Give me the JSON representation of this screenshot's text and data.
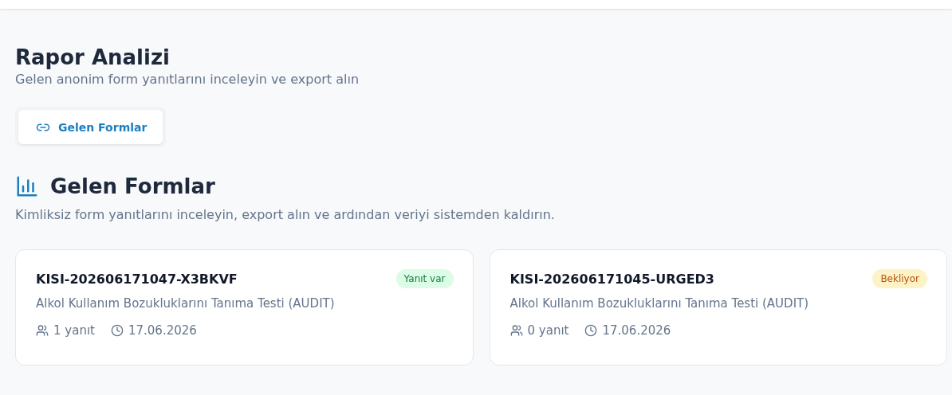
{
  "page": {
    "title": "Rapor Analizi",
    "subtitle": "Gelen anonim form yanıtlarını inceleyin ve export alın"
  },
  "tabs": [
    {
      "label": "Gelen Formlar",
      "selected": true
    }
  ],
  "section": {
    "title": "Gelen Formlar",
    "description": "Kimliksiz form yanıtlarını inceleyin, export alın ve ardından veriyi sistemden kaldırın."
  },
  "forms": [
    {
      "code": "KISI-202606171047-X3BKVF",
      "test": "Alkol Kullanım Bozukluklarını Tanıma Testi (AUDIT)",
      "responses": "1 yanıt",
      "date": "17.06.2026",
      "status": {
        "kind": "answered",
        "label": "Yanıt var"
      }
    },
    {
      "code": "KISI-202606171045-URGED3",
      "test": "Alkol Kullanım Bozukluklarını Tanıma Testi (AUDIT)",
      "responses": "0 yanıt",
      "date": "17.06.2026",
      "status": {
        "kind": "pending",
        "label": "Bekliyor"
      }
    }
  ]
}
